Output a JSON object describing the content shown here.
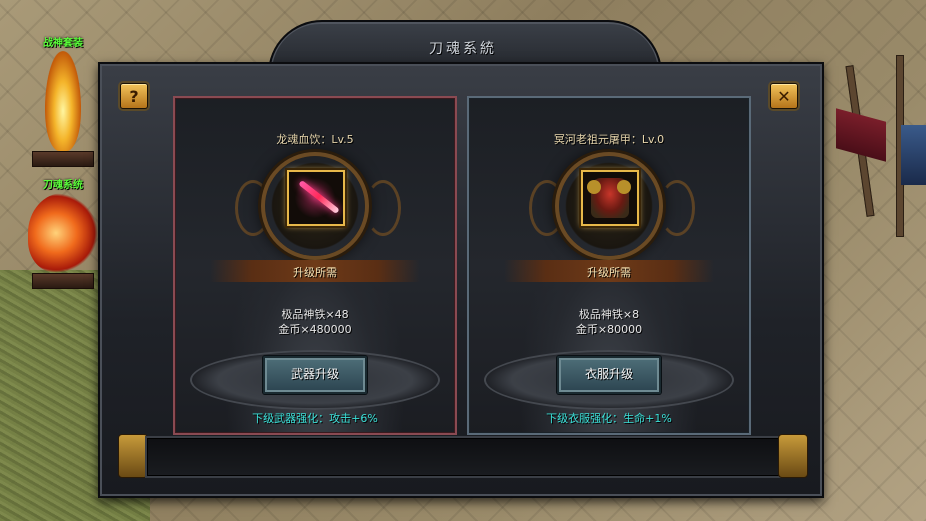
{
  "scene": {
    "labels": [
      "战神套装",
      "刀魂系统"
    ]
  },
  "dialog": {
    "title": "刀魂系統",
    "help_label": "?",
    "close_label": "✕"
  },
  "cards": [
    {
      "name": "龙魂血饮：Lv.5",
      "item_icon": "sword-icon",
      "requirement_label": "升级所需",
      "cost_lines": [
        "极品神铁×48",
        "金币×480000"
      ],
      "button_label": "武器升级",
      "bonus_text": "下级武器强化：攻击+6%",
      "border_color": "#8a4a52"
    },
    {
      "name": "冥河老祖元屠甲：Lv.0",
      "item_icon": "armor-icon",
      "requirement_label": "升级所需",
      "cost_lines": [
        "极品神铁×8",
        "金币×80000"
      ],
      "button_label": "衣服升级",
      "bonus_text": "下级衣服强化：生命+1%",
      "border_color": "#5a6a78"
    }
  ],
  "colors": {
    "accent_gold": "#e7b84a",
    "bonus_text": "#3ae0d8",
    "scene_label": "#5bff3a"
  }
}
